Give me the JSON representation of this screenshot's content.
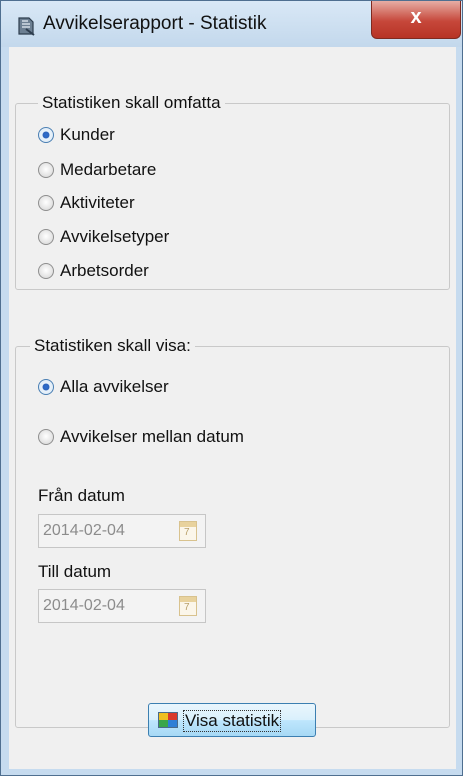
{
  "window": {
    "title": "Avvikelserapport - Statistik",
    "close_label": "x"
  },
  "scope_group": {
    "legend": "Statistiken skall omfatta",
    "options": [
      {
        "label": "Kunder",
        "checked": true
      },
      {
        "label": "Medarbetare",
        "checked": false
      },
      {
        "label": "Aktiviteter",
        "checked": false
      },
      {
        "label": "Avvikelsetyper",
        "checked": false
      },
      {
        "label": "Arbetsorder",
        "checked": false
      }
    ]
  },
  "show_group": {
    "legend": "Statistiken skall visa:",
    "options": [
      {
        "label": "Alla avvikelser",
        "checked": true
      },
      {
        "label": "Avvikelser mellan datum",
        "checked": false
      }
    ],
    "from_label": "Från datum",
    "from_value": "2014-02-04",
    "to_label": "Till datum",
    "to_value": "2014-02-04",
    "calendar_day": "7"
  },
  "actions": {
    "show_stats_label": "Visa statistik"
  },
  "colors": {
    "title_bar": "#c6dbef",
    "close_button": "#c6473a",
    "client_background": "#f0f0f0",
    "button_border": "#3c7fb1"
  }
}
